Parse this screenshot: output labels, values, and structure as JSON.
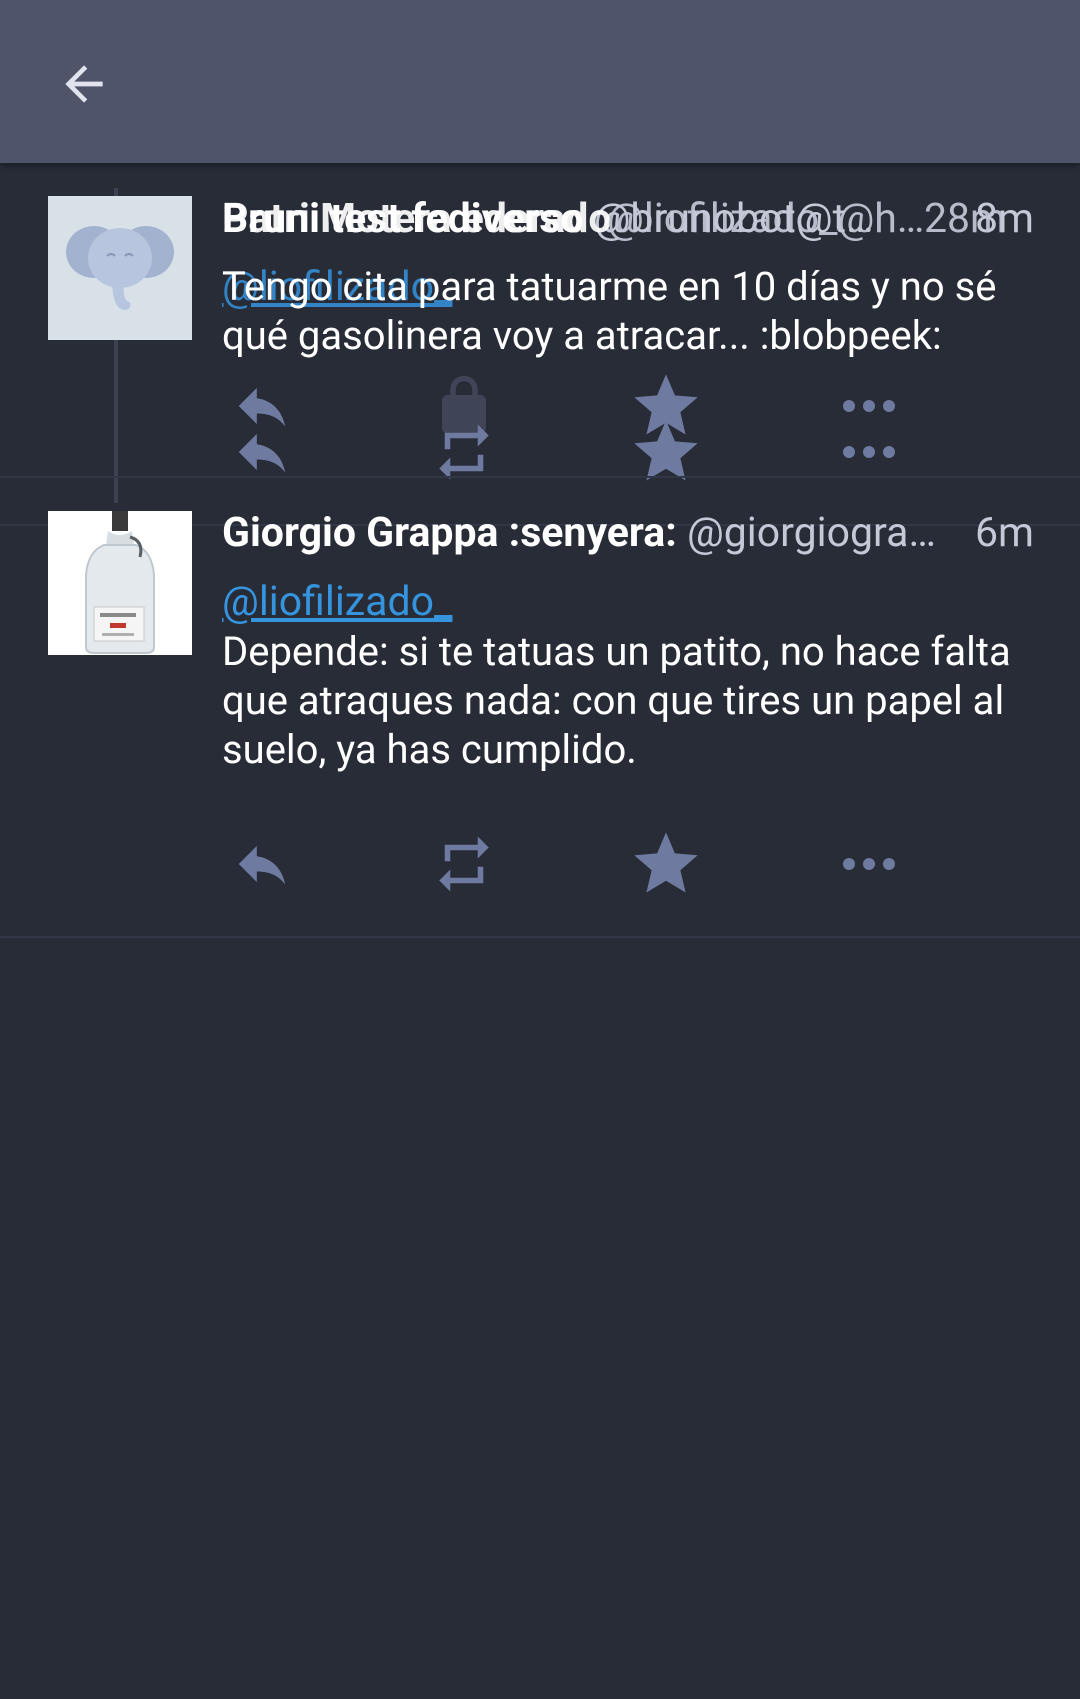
{
  "appbar": {
    "back_icon": "arrow-left-icon"
  },
  "colors": {
    "appbar": "#4f546b",
    "background": "#282c37",
    "mention": "#3694df",
    "icon": "#6e7aa0",
    "secondary_text": "#c4c9d8"
  },
  "ghost_status": {
    "display_name": "Patri Motera ederado",
    "account": "@liofilizado_@h…",
    "time": "28m",
    "mention": "@liofilizado_",
    "icons": [
      "reply-icon",
      "lock-icon",
      "star-icon",
      "more-icon"
    ]
  },
  "status1": {
    "display_name": "Bruni test fediverso",
    "account": "@brunobot@t…",
    "time": "8m",
    "content": "Tengo cita para tatuarme en 10 días y no sé qué gasolinera voy a atracar... :blobpeek:",
    "icons": [
      "reply-icon",
      "boost-icon",
      "favourite-icon",
      "more-icon"
    ]
  },
  "status2": {
    "display_name": "Giorgio Grappa :senyera:",
    "account": "@giorgiogra…",
    "time": "6m",
    "mention": "@liofilizado_",
    "content": "Depende: si te tatuas un patito, no hace falta que atraques nada: con que tires un papel al suelo, ya has cumplido.",
    "icons": [
      "reply-icon",
      "boost-icon",
      "favourite-icon",
      "more-icon"
    ]
  }
}
